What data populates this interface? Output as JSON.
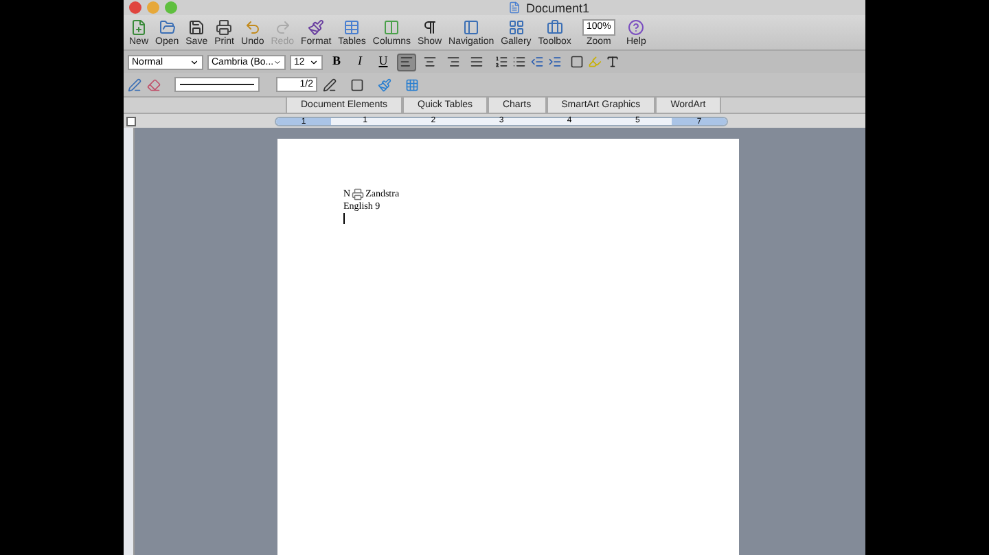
{
  "window": {
    "title": "Document1"
  },
  "toolbar": {
    "buttons": [
      {
        "label": "New",
        "kind": "new",
        "disabled": false
      },
      {
        "label": "Open",
        "kind": "open",
        "disabled": false
      },
      {
        "label": "Save",
        "kind": "save",
        "disabled": false
      },
      {
        "label": "Print",
        "kind": "print",
        "disabled": false
      },
      {
        "label": "Undo",
        "kind": "undo",
        "disabled": false
      },
      {
        "label": "Redo",
        "kind": "redo",
        "disabled": true
      },
      {
        "label": "Format",
        "kind": "format",
        "disabled": false
      },
      {
        "label": "Tables",
        "kind": "tables",
        "disabled": false
      },
      {
        "label": "Columns",
        "kind": "columns",
        "disabled": false
      },
      {
        "label": "Show",
        "kind": "show",
        "disabled": false
      },
      {
        "label": "Navigation",
        "kind": "navigation",
        "disabled": false
      },
      {
        "label": "Gallery",
        "kind": "gallery",
        "disabled": false
      },
      {
        "label": "Toolbox",
        "kind": "toolbox",
        "disabled": false
      },
      {
        "label": "Zoom",
        "kind": "zoom",
        "value": "100%",
        "disabled": false
      },
      {
        "label": "Help",
        "kind": "help",
        "disabled": false
      }
    ]
  },
  "formatting": {
    "style": "Normal",
    "font": "Cambria (Bo...",
    "size": "12",
    "bold": "B",
    "italic": "I",
    "underline": "U",
    "alignments": [
      {
        "kind": "left",
        "selected": true
      },
      {
        "kind": "center",
        "selected": false
      },
      {
        "kind": "right",
        "selected": false
      },
      {
        "kind": "justify",
        "selected": false
      }
    ]
  },
  "drawing_bar": {
    "line_weight": "1/2"
  },
  "ribbon_tabs": [
    {
      "label": "Document Elements",
      "selected": false
    },
    {
      "label": "Quick Tables",
      "selected": false
    },
    {
      "label": "Charts",
      "selected": false
    },
    {
      "label": "SmartArt Graphics",
      "selected": false
    },
    {
      "label": "WordArt",
      "selected": false
    }
  ],
  "ruler": {
    "numbers": [
      "1",
      "1",
      "2",
      "3",
      "4",
      "5",
      "7"
    ]
  },
  "document": {
    "lines": [
      {
        "prefix": "N",
        "text": "Zandstra"
      },
      {
        "text": "English 9"
      }
    ]
  }
}
